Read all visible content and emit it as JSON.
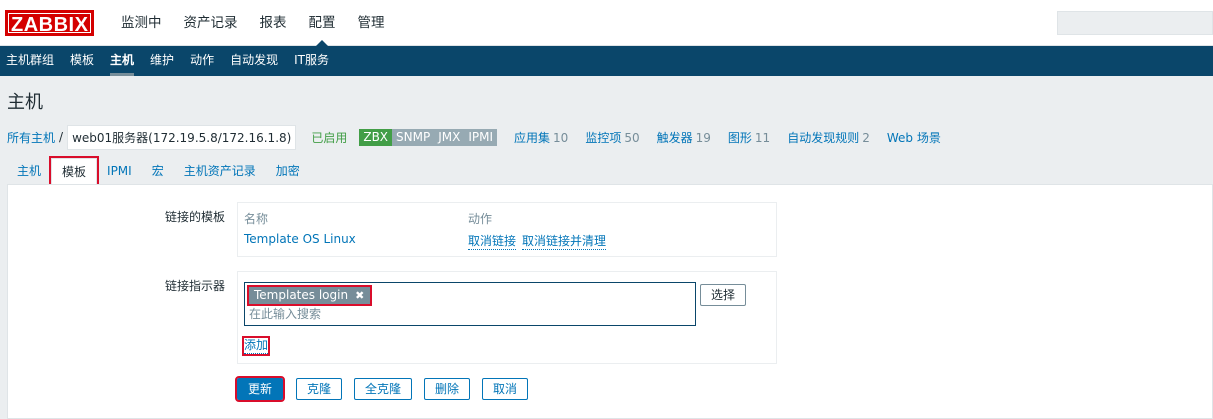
{
  "app": {
    "logo": "ZABBIX",
    "top_menu": [
      "监测中",
      "资产记录",
      "报表",
      "配置",
      "管理"
    ],
    "top_menu_active": "配置"
  },
  "sub_menu": [
    "主机群组",
    "模板",
    "主机",
    "维护",
    "动作",
    "自动发现",
    "IT服务"
  ],
  "sub_menu_active": "主机",
  "page_title": "主机",
  "hostbar": {
    "all_hosts": "所有主机",
    "separator": "/",
    "current_host": "web01服务器(172.19.5.8/172.16.1.8)",
    "status": "已启用",
    "badges": [
      {
        "label": "ZBX",
        "color": "#429e47"
      },
      {
        "label": "SNMP",
        "color": "#97aab3"
      },
      {
        "label": "JMX",
        "color": "#97aab3"
      },
      {
        "label": "IPMI",
        "color": "#97aab3"
      }
    ],
    "stats": [
      {
        "label": "应用集",
        "count": "10"
      },
      {
        "label": "监控项",
        "count": "50"
      },
      {
        "label": "触发器",
        "count": "19"
      },
      {
        "label": "图形",
        "count": "11"
      },
      {
        "label": "自动发现规则",
        "count": "2"
      },
      {
        "label": "Web 场景",
        "count": ""
      }
    ]
  },
  "tabs": [
    "主机",
    "模板",
    "IPMI",
    "宏",
    "主机资产记录",
    "加密"
  ],
  "tabs_active": "模板",
  "form": {
    "linked_label": "链接的模板",
    "linked_table": {
      "col_name": "名称",
      "col_action": "动作",
      "row": {
        "name": "Template OS Linux",
        "unlink": "取消链接",
        "unlink_clear": "取消链接并清理"
      }
    },
    "link_new_label": "链接指示器",
    "chip_label": "Templates login",
    "search_placeholder": "在此输入搜索",
    "select_button": "选择",
    "add_link": "添加"
  },
  "buttons": {
    "update": "更新",
    "clone": "克隆",
    "full_clone": "全克隆",
    "delete": "删除",
    "cancel": "取消"
  },
  "colors": {
    "nav_bg": "#0a466a",
    "link": "#0275b8",
    "highlight": "#d90d2b",
    "logo_red": "#d40000",
    "enabled_green": "#429e47"
  }
}
